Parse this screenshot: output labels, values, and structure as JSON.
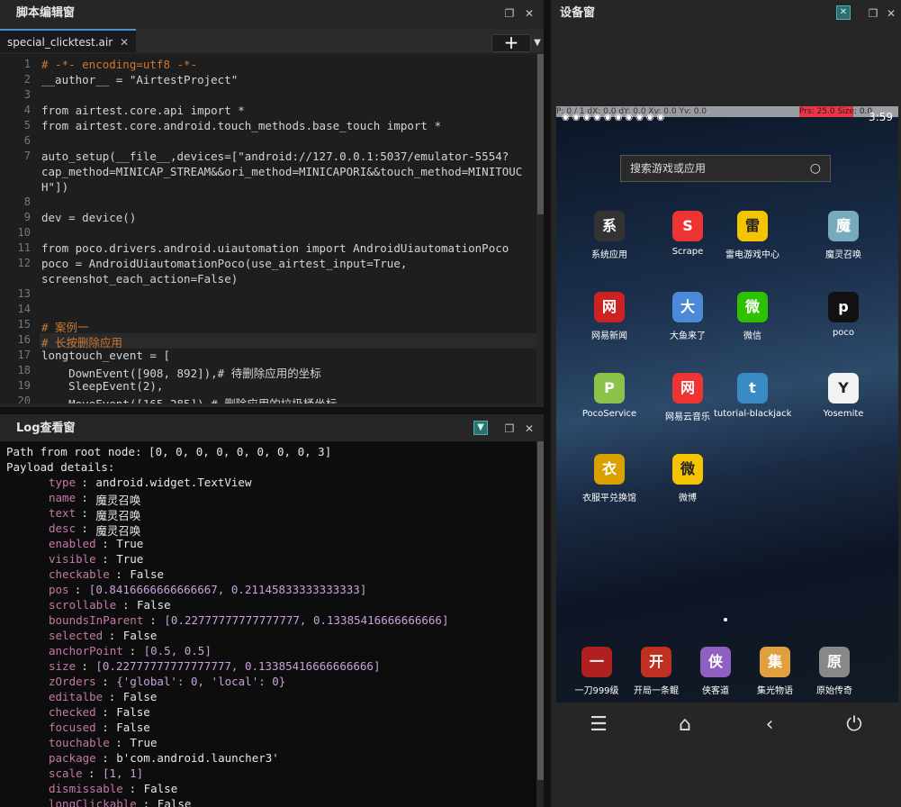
{
  "editor": {
    "title": "脚本编辑窗",
    "tab_label": "special_clicktest.air",
    "tab_close": "✕",
    "add_label": "+",
    "dropdown": "▼",
    "lines": [
      {
        "n": "1",
        "t": "# -*- encoding=utf8 -*-"
      },
      {
        "n": "2",
        "t": "__author__ = \"AirtestProject\""
      },
      {
        "n": "3",
        "t": ""
      },
      {
        "n": "4",
        "t": "from airtest.core.api import *"
      },
      {
        "n": "5",
        "t": "from airtest.core.android.touch_methods.base_touch import *"
      },
      {
        "n": "6",
        "t": ""
      },
      {
        "n": "7",
        "t": "auto_setup(__file__,devices=[\"android://127.0.0.1:5037/emulator-5554?"
      },
      {
        "n": "",
        "t": "cap_method=MINICAP_STREAM&&ori_method=MINICAPORI&&touch_method=MINITOUC"
      },
      {
        "n": "",
        "t": "H\"])"
      },
      {
        "n": "8",
        "t": ""
      },
      {
        "n": "9",
        "t": "dev = device()"
      },
      {
        "n": "10",
        "t": ""
      },
      {
        "n": "11",
        "t": "from poco.drivers.android.uiautomation import AndroidUiautomationPoco"
      },
      {
        "n": "12",
        "t": "poco = AndroidUiautomationPoco(use_airtest_input=True,"
      },
      {
        "n": "",
        "t": "screenshot_each_action=False)"
      },
      {
        "n": "13",
        "t": ""
      },
      {
        "n": "14",
        "t": ""
      },
      {
        "n": "15",
        "t": "# 案例一"
      },
      {
        "n": "16",
        "t": "# 长按删除应用"
      },
      {
        "n": "17",
        "t": "longtouch_event = ["
      },
      {
        "n": "18",
        "t": "    DownEvent([908, 892]),# 待删除应用的坐标"
      },
      {
        "n": "19",
        "t": "    SleepEvent(2),"
      },
      {
        "n": "20",
        "t": "    MoveEvent([165,285]),# 删除应用的垃圾桶坐标"
      }
    ]
  },
  "log": {
    "title": "Log查看窗",
    "path_line": "Path from root node: [0, 0, 0, 0, 0, 0, 0, 0, 3]",
    "payload_label": "Payload details:",
    "fields": [
      {
        "k": "type",
        "v": "android.widget.TextView"
      },
      {
        "k": "name",
        "v": "魔灵召唤"
      },
      {
        "k": "text",
        "v": "魔灵召唤"
      },
      {
        "k": "desc",
        "v": "魔灵召唤"
      },
      {
        "k": "enabled",
        "v": "True"
      },
      {
        "k": "visible",
        "v": "True"
      },
      {
        "k": "checkable",
        "v": "False"
      },
      {
        "k": "pos",
        "v": "[0.8416666666666667, 0.21145833333333333]"
      },
      {
        "k": "scrollable",
        "v": "False"
      },
      {
        "k": "boundsInParent",
        "v": "[0.22777777777777777, 0.13385416666666666]"
      },
      {
        "k": "selected",
        "v": "False"
      },
      {
        "k": "anchorPoint",
        "v": "[0.5, 0.5]"
      },
      {
        "k": "size",
        "v": "[0.22777777777777777, 0.13385416666666666]"
      },
      {
        "k": "zOrders",
        "v": "{'global': 0, 'local': 0}"
      },
      {
        "k": "editalbe",
        "v": "False"
      },
      {
        "k": "checked",
        "v": "False"
      },
      {
        "k": "focused",
        "v": "False"
      },
      {
        "k": "touchable",
        "v": "True"
      },
      {
        "k": "package",
        "v": "b'com.android.launcher3'"
      },
      {
        "k": "scale",
        "v": "[1, 1]"
      },
      {
        "k": "dismissable",
        "v": "False"
      },
      {
        "k": "longClickable",
        "v": "False"
      }
    ]
  },
  "device": {
    "title": "设备窗",
    "debug_bar": "P: 0 / 1    dX: 0.0    dY: 0.0    Xv: 0.0    Yv: 0.0",
    "debug_red": "Prs: 25.0  Size: 0.0",
    "clock": "3:59",
    "search_placeholder": "搜索游戏或应用",
    "apps": [
      {
        "label": "系统应用",
        "icon": "grid-icon",
        "color": "#333"
      },
      {
        "label": "Scrape",
        "icon": "g-icon",
        "color": "#e33"
      },
      {
        "label": "雷电游戏中心",
        "icon": "gamepad-icon",
        "color": "#f5c400"
      },
      {
        "label": "魔灵召唤",
        "icon": "anime-icon",
        "color": "#7ab"
      },
      {
        "label": "网易新闻",
        "icon": "news-icon",
        "color": "#c22"
      },
      {
        "label": "大鱼来了",
        "icon": "fish-icon",
        "color": "#4a8ad8"
      },
      {
        "label": "微信",
        "icon": "wechat-icon",
        "color": "#2dc100"
      },
      {
        "label": "poco",
        "icon": "unity-icon",
        "color": "#111"
      },
      {
        "label": "PocoService",
        "icon": "android-icon",
        "color": "#8bc34a"
      },
      {
        "label": "网易云音乐",
        "icon": "music-icon",
        "color": "#e33"
      },
      {
        "label": "tutorial-blackjack",
        "icon": "blackjack-icon",
        "color": "#3a8ac4"
      },
      {
        "label": "Yosemite",
        "icon": "yosemite-icon",
        "color": "#f2f2f2"
      },
      {
        "label": "衣服平兑换馆",
        "icon": "shop-icon",
        "color": "#d8a000"
      },
      {
        "label": "微博",
        "icon": "weibo-icon",
        "color": "#f5c400"
      }
    ],
    "dock": [
      {
        "label": "一刀999级",
        "color": "#b02020"
      },
      {
        "label": "开局一条鲲",
        "color": "#c03020"
      },
      {
        "label": "侠客道",
        "color": "#9060c0"
      },
      {
        "label": "集光物语",
        "color": "#e0a040"
      },
      {
        "label": "原始传奇",
        "color": "#888"
      }
    ],
    "nav": {
      "menu": "☰",
      "home": "⌂",
      "back": "‹",
      "power": "⏻"
    }
  },
  "window_buttons": {
    "restore": "❐",
    "close": "✕"
  }
}
